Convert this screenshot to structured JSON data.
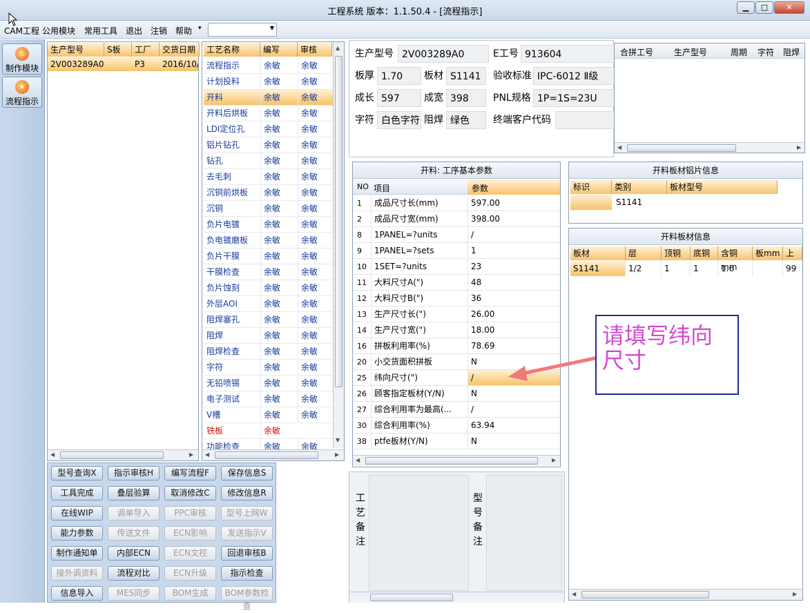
{
  "window": {
    "title": "工程系统   版本：1.1.50.4 - [流程指示]",
    "min": "▁",
    "max": "□",
    "close": "✕"
  },
  "menu": {
    "items": [
      "CAM工程",
      "公用模块",
      "常用工具",
      "退出",
      "注销",
      "帮助"
    ],
    "help_arrow": "▾",
    "combo_value": "",
    "mdi": [
      "▁",
      "🗗",
      "✕"
    ]
  },
  "toolbar": [
    {
      "label": "制作模块",
      "icon": "flame-icon"
    },
    {
      "label": "流程指示",
      "icon": "pause-icon"
    }
  ],
  "orders": {
    "headers": [
      "生产型号",
      "S板",
      "工厂",
      "交货日期"
    ],
    "rows": [
      {
        "model": "2V003289A0",
        "s": "",
        "factory": "P3",
        "date": "2016/10/"
      }
    ]
  },
  "process": {
    "headers": [
      "工艺名称",
      "编写",
      "审核"
    ],
    "rows": [
      {
        "name": "流程指示",
        "w": "余敏",
        "r": "余敏"
      },
      {
        "name": "计划投料",
        "w": "余敏",
        "r": "余敏"
      },
      {
        "name": "开料",
        "w": "余敏",
        "r": "余敏"
      },
      {
        "name": "开料后烘板",
        "w": "余敏",
        "r": "余敏"
      },
      {
        "name": "LDI定位孔",
        "w": "余敏",
        "r": "余敏"
      },
      {
        "name": "铝片钻孔",
        "w": "余敏",
        "r": "余敏"
      },
      {
        "name": "钻孔",
        "w": "余敏",
        "r": "余敏"
      },
      {
        "name": "去毛刺",
        "w": "余敏",
        "r": "余敏"
      },
      {
        "name": "沉铜前烘板",
        "w": "余敏",
        "r": "余敏"
      },
      {
        "name": "沉铜",
        "w": "余敏",
        "r": "余敏"
      },
      {
        "name": "负片电镀",
        "w": "余敏",
        "r": "余敏"
      },
      {
        "name": "负电镀磨板",
        "w": "余敏",
        "r": "余敏"
      },
      {
        "name": "负片干膜",
        "w": "余敏",
        "r": "余敏"
      },
      {
        "name": "干膜检查",
        "w": "余敏",
        "r": "余敏"
      },
      {
        "name": "负片蚀刻",
        "w": "余敏",
        "r": "余敏"
      },
      {
        "name": "外层AOI",
        "w": "余敏",
        "r": "余敏"
      },
      {
        "name": "阻焊塞孔",
        "w": "余敏",
        "r": "余敏"
      },
      {
        "name": "阻焊",
        "w": "余敏",
        "r": "余敏"
      },
      {
        "name": "阻焊检查",
        "w": "余敏",
        "r": "余敏"
      },
      {
        "name": "字符",
        "w": "余敏",
        "r": "余敏"
      },
      {
        "name": "无铅喷锡",
        "w": "余敏",
        "r": "余敏"
      },
      {
        "name": "电子测试",
        "w": "余敏",
        "r": "余敏"
      },
      {
        "name": "V槽",
        "w": "余敏",
        "r": "余敏"
      },
      {
        "name": "铣板",
        "w": "余敏",
        "r": ""
      },
      {
        "name": "功能检查",
        "w": "余敏",
        "r": "余敏"
      }
    ]
  },
  "info": {
    "model_label": "生产型号",
    "model": "2V003289A0",
    "eno_label": "E工号",
    "eno": "913604",
    "thick_label": "板厚",
    "thick": "1.70",
    "mat_label": "板材",
    "mat": "S1141",
    "std_label": "验收标准",
    "std": "IPC-6012 Ⅱ级",
    "len_label": "成长",
    "len": "597",
    "wid_label": "成宽",
    "wid": "398",
    "pnl_label": "PNL规格",
    "pnl": "1P=1S=23U",
    "char_label": "字符",
    "char": "白色字符",
    "mask_label": "阻焊",
    "mask": "绿色",
    "cust_label": "终端客户代码",
    "cust": ""
  },
  "combine": {
    "headers": [
      "合拼工号",
      "生产型号",
      "周期",
      "字符",
      "阻焊"
    ]
  },
  "params": {
    "title": "开料: 工序基本参数",
    "headers": [
      "NO",
      "项目",
      "参数"
    ],
    "rows": [
      {
        "no": "1",
        "item": "成品尺寸长(mm)",
        "val": "597.00"
      },
      {
        "no": "2",
        "item": "成品尺寸宽(mm)",
        "val": "398.00"
      },
      {
        "no": "8",
        "item": "1PANEL=?units",
        "val": "/"
      },
      {
        "no": "9",
        "item": "1PANEL=?sets",
        "val": "1"
      },
      {
        "no": "10",
        "item": "1SET=?units",
        "val": "23"
      },
      {
        "no": "11",
        "item": "大料尺寸A(\")",
        "val": "48"
      },
      {
        "no": "12",
        "item": "大料尺寸B(\")",
        "val": "36"
      },
      {
        "no": "13",
        "item": "生产尺寸长(\")",
        "val": "26.00"
      },
      {
        "no": "14",
        "item": "生产尺寸宽(\")",
        "val": "18.00"
      },
      {
        "no": "16",
        "item": "拼板利用率(%)",
        "val": "78.69"
      },
      {
        "no": "20",
        "item": "小交货面积拼板",
        "val": "N"
      },
      {
        "no": "25",
        "item": "纬向尺寸(\")",
        "val": "/"
      },
      {
        "no": "26",
        "item": "顾客指定板材(Y/N)",
        "val": "N"
      },
      {
        "no": "27",
        "item": "综合利用率为最高(...",
        "val": "/"
      },
      {
        "no": "30",
        "item": "综合利用率(%)",
        "val": "63.94"
      },
      {
        "no": "38",
        "item": "ptfe板材(Y/N)",
        "val": "N"
      }
    ]
  },
  "alu": {
    "title": "开料板材铝片信息",
    "headers": [
      "标识",
      "类别",
      "板材型号"
    ],
    "row": {
      "mark": "",
      "cat": "S1141",
      "type": ""
    }
  },
  "sheet": {
    "title": "开料板材信息",
    "headers": [
      "板材",
      "层",
      "顶铜",
      "底铜",
      "含铜mm",
      "板mm",
      "上"
    ],
    "row": [
      "S1141",
      "1/2",
      "1",
      "1",
      "1.6",
      "",
      "99"
    ]
  },
  "buttons": [
    {
      "label": "型号查询X",
      "enabled": true
    },
    {
      "label": "指示审核H",
      "enabled": true
    },
    {
      "label": "编写流程F",
      "enabled": true
    },
    {
      "label": "保存信息S",
      "enabled": true
    },
    {
      "label": "工具完成",
      "enabled": true
    },
    {
      "label": "叠层验算",
      "enabled": true
    },
    {
      "label": "取消修改C",
      "enabled": true
    },
    {
      "label": "修改信息R",
      "enabled": true
    },
    {
      "label": "在线WIP",
      "enabled": true
    },
    {
      "label": "调单导入",
      "enabled": false
    },
    {
      "label": "PPC审核",
      "enabled": false
    },
    {
      "label": "型号上网W",
      "enabled": false
    },
    {
      "label": "能力参数",
      "enabled": true
    },
    {
      "label": "传送文件",
      "enabled": false
    },
    {
      "label": "ECN影响",
      "enabled": false
    },
    {
      "label": "发送指示V",
      "enabled": false
    },
    {
      "label": "制作通知单",
      "enabled": true
    },
    {
      "label": "内部ECN",
      "enabled": true
    },
    {
      "label": "ECN文控",
      "enabled": false
    },
    {
      "label": "回退审核B",
      "enabled": true
    },
    {
      "label": "接外调资料",
      "enabled": false
    },
    {
      "label": "流程对比",
      "enabled": true
    },
    {
      "label": "ECN升级",
      "enabled": false
    },
    {
      "label": "指示检查",
      "enabled": true
    },
    {
      "label": "信息导入",
      "enabled": true
    },
    {
      "label": "MES同步",
      "enabled": false
    },
    {
      "label": "BOM生成",
      "enabled": false
    },
    {
      "label": "BOM参数检查",
      "enabled": false
    }
  ],
  "notes": {
    "process": [
      "工",
      "艺",
      "备",
      "注"
    ],
    "model": [
      "型",
      "号",
      "备",
      "注"
    ]
  },
  "callout": {
    "line1": "请填写纬向",
    "line2": "尺寸"
  },
  "colors": {
    "selected": "#f7c36a",
    "callout_border": "#1f2a9c",
    "callout_text": "#d34bd0",
    "arrow": "#f07a7a"
  }
}
